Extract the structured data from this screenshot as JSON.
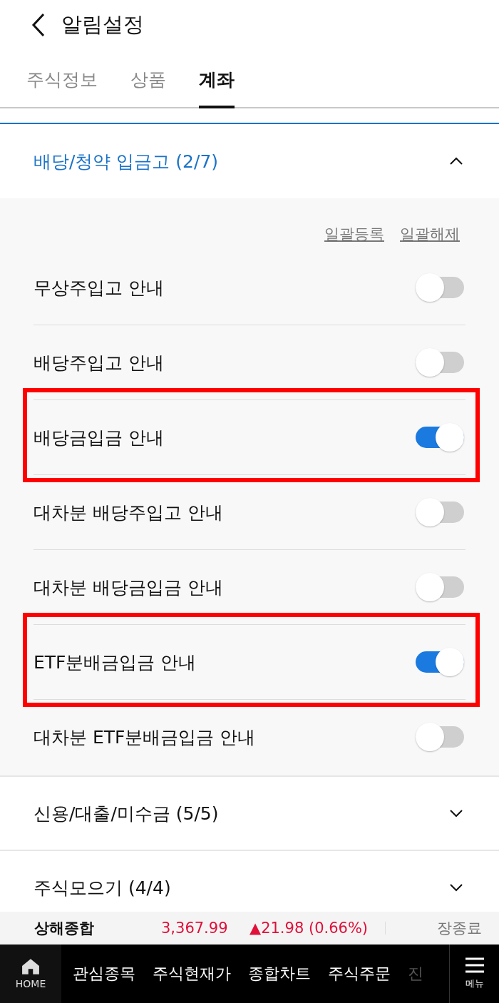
{
  "header": {
    "title": "알림설정"
  },
  "tabs": [
    {
      "label": "주식정보",
      "selected": false
    },
    {
      "label": "상품",
      "selected": false
    },
    {
      "label": "계좌",
      "selected": true
    }
  ],
  "sections": [
    {
      "title": "배당/청약 입금고 (2/7)",
      "expanded": true,
      "bulk_actions": [
        "일괄등록",
        "일괄해제"
      ],
      "rows": [
        {
          "label": "무상주입고 안내",
          "on": false,
          "highlighted": false
        },
        {
          "label": "배당주입고 안내",
          "on": false,
          "highlighted": false
        },
        {
          "label": "배당금입금 안내",
          "on": true,
          "highlighted": true
        },
        {
          "label": "대차분 배당주입고 안내",
          "on": false,
          "highlighted": false
        },
        {
          "label": "대차분 배당금입금 안내",
          "on": false,
          "highlighted": false
        },
        {
          "label": "ETF분배금입금 안내",
          "on": true,
          "highlighted": true
        },
        {
          "label": "대차분 ETF분배금입금 안내",
          "on": false,
          "highlighted": false
        }
      ]
    },
    {
      "title": "신용/대출/미수금 (5/5)",
      "expanded": false
    },
    {
      "title": "주식모으기 (4/4)",
      "expanded": false
    }
  ],
  "ticker": {
    "name": "상해종합",
    "value": "3,367.99",
    "change": "▲21.98 (0.66%)",
    "status": "장종료"
  },
  "bottom_nav": {
    "home": "HOME",
    "items": [
      "관심종목",
      "주식현재가",
      "종합차트",
      "주식주문",
      "진"
    ],
    "menu": "메뉴"
  }
}
